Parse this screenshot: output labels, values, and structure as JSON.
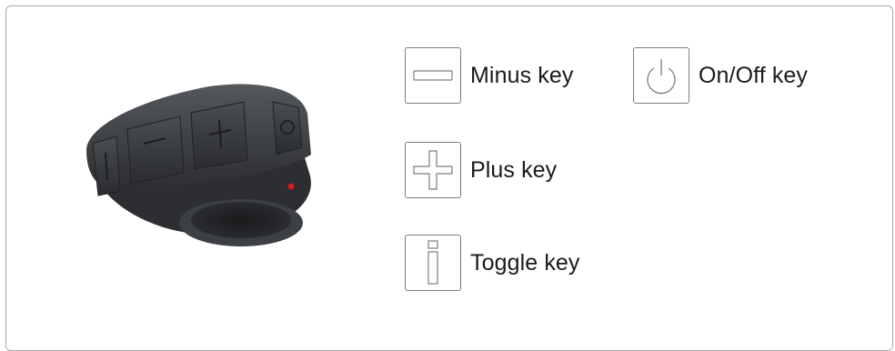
{
  "legend": {
    "minus": {
      "label": "Minus key",
      "icon": "minus-icon"
    },
    "onoff": {
      "label": "On/Off key",
      "icon": "power-icon"
    },
    "plus": {
      "label": "Plus key",
      "icon": "plus-icon"
    },
    "toggle": {
      "label": "Toggle key",
      "icon": "toggle-icon"
    }
  },
  "colors": {
    "device_body": "#3a3c3f",
    "led": "#d41e1e",
    "icon_stroke": "#7d7d7d"
  }
}
